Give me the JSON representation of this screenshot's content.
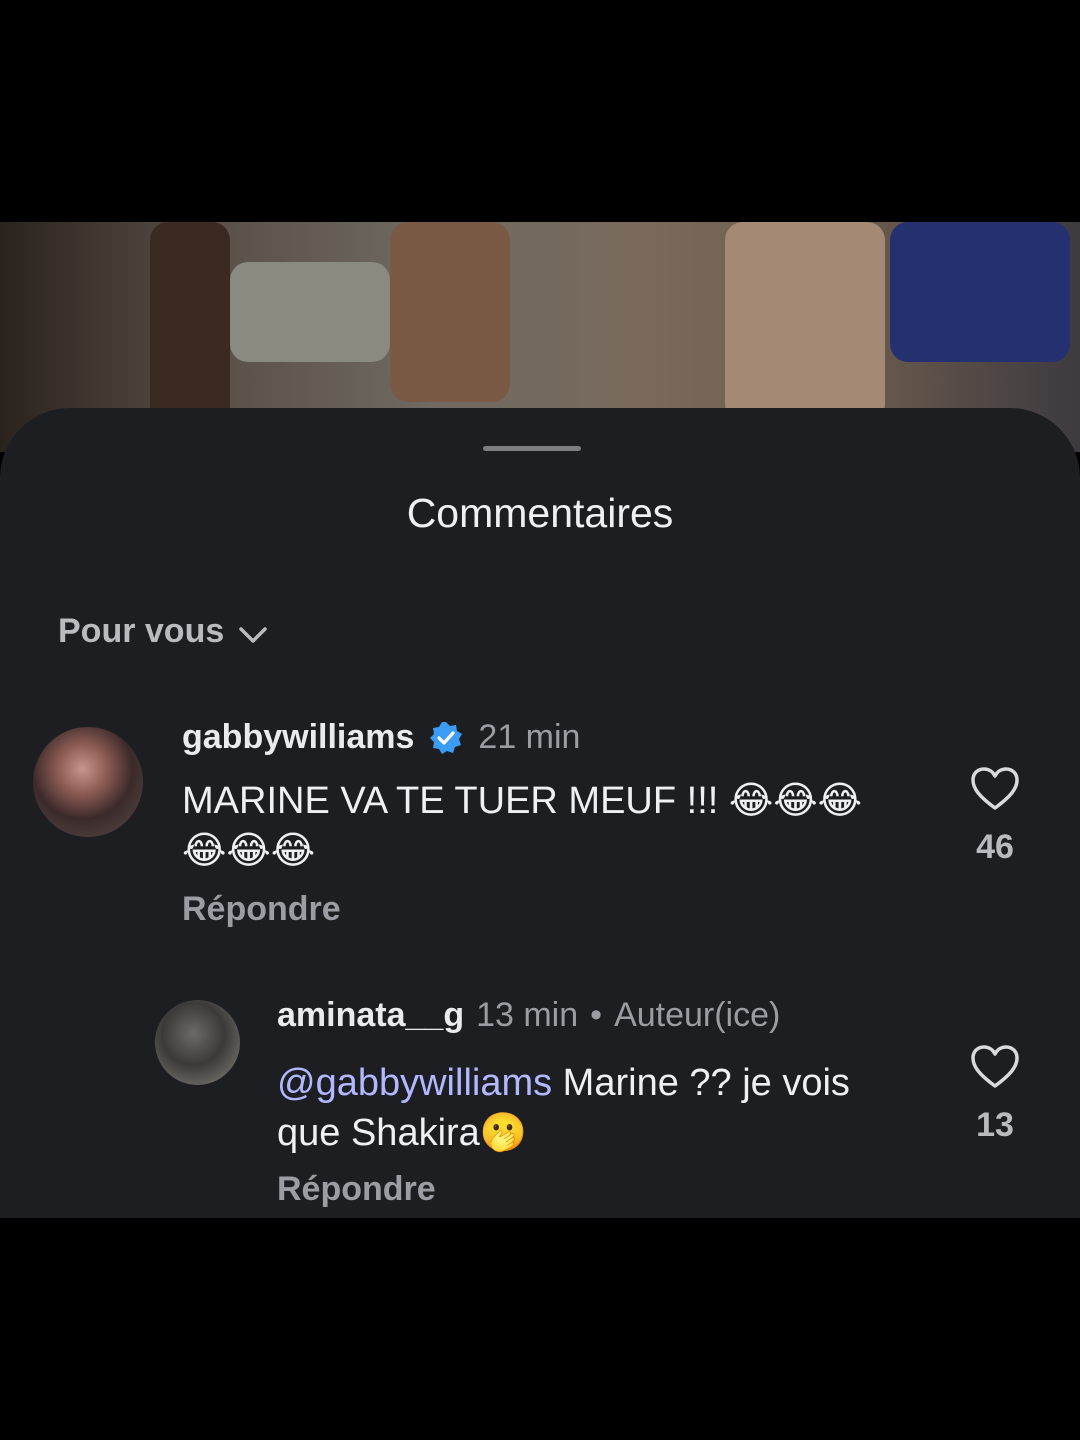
{
  "sheet": {
    "title": "Commentaires",
    "sort_label": "Pour vous"
  },
  "comments": [
    {
      "username": "gabbywilliams",
      "verified": true,
      "time": "21 min",
      "text": "MARINE VA TE TUER MEUF !!! 😂😂😂😂😂😂",
      "reply_label": "Répondre",
      "likes": "46"
    },
    {
      "username": "aminata__g",
      "time": "13 min",
      "separator": "•",
      "author_badge": "Auteur(ice)",
      "mention": "@gabbywilliams",
      "text": " Marine ?? je vois que Shakira🫢",
      "reply_label": "Répondre",
      "likes": "13"
    }
  ],
  "colors": {
    "sheet_bg": "#1d1e22",
    "mention": "#b3b7ff",
    "verified": "#3b9cf5"
  },
  "icons": [
    "chevron-down-icon",
    "verified-badge-icon",
    "heart-icon"
  ]
}
